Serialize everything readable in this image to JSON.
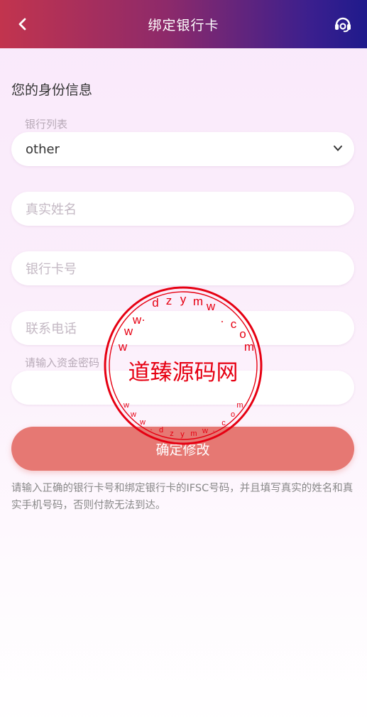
{
  "header": {
    "title": "绑定银行卡",
    "back_icon": "chevron-left-icon",
    "service_icon": "customer-service-headset-icon"
  },
  "section": {
    "title": "您的身份信息"
  },
  "form": {
    "bank_list_label": "银行列表",
    "bank_selected": "other",
    "real_name_placeholder": "真实姓名",
    "card_number_placeholder": "银行卡号",
    "phone_placeholder": "联系电话",
    "fund_password_label": "请输入资金密码",
    "fund_password_value": ""
  },
  "submit_label": "确定修改",
  "note": "请输入正确的银行卡号和绑定银行卡的IFSC号码，并且填写真实的姓名和真实手机号码，否则付款无法到达。",
  "watermark": {
    "center_text": "道臻源码网",
    "ring_text": "www.dzym.com"
  },
  "colors": {
    "header_start": "#c2344e",
    "header_end": "#1f1a8c",
    "button": "#e67873",
    "stamp": "#e60012"
  }
}
